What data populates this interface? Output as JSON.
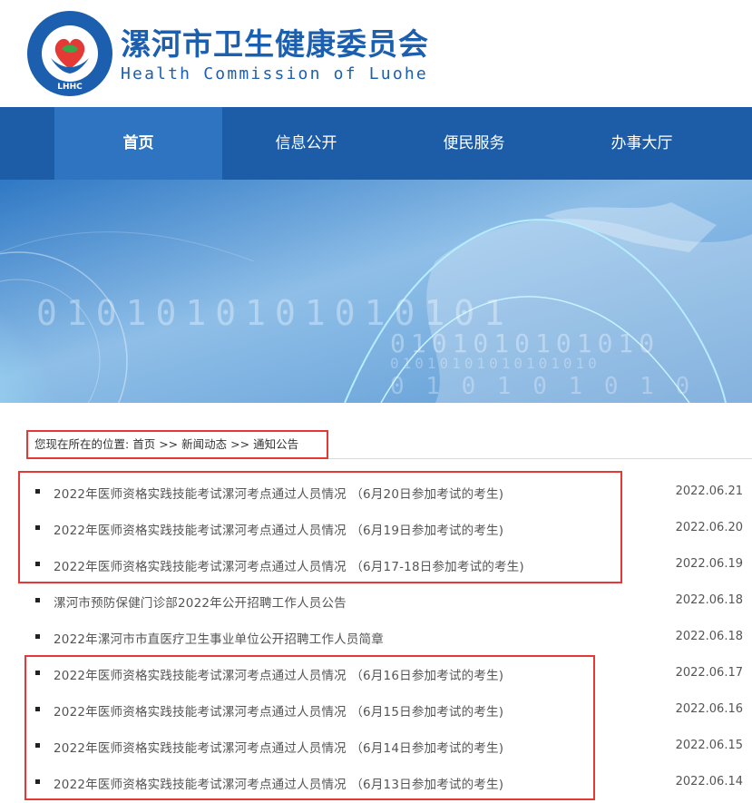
{
  "header": {
    "title_cn": "漯河市卫生健康委员会",
    "title_en": "Health Commission of Luohe",
    "logo_ring_text": "漯河市卫生健康委员会",
    "logo_abbr": "LHHC"
  },
  "nav": {
    "items": [
      {
        "label": "首页",
        "active": true
      },
      {
        "label": "信息公开",
        "active": false
      },
      {
        "label": "便民服务",
        "active": false
      },
      {
        "label": "办事大厅",
        "active": false
      }
    ]
  },
  "banner": {
    "digits_row1": "0101010101010101",
    "digits_row2": "0101010101010",
    "digits_row3": "01010101010101010",
    "digits_row4": "0 1 0 1 0 1 0 1 0"
  },
  "breadcrumb": {
    "prefix": "您现在所在的位置:",
    "home": "首页",
    "sep1": ">>",
    "section": "新闻动态",
    "sep2": ">>",
    "current": "通知公告"
  },
  "news": [
    {
      "title": "2022年医师资格实践技能考试漯河考点通过人员情况 （6月20日参加考试的考生)",
      "date": "2022.06.21"
    },
    {
      "title": "2022年医师资格实践技能考试漯河考点通过人员情况 （6月19日参加考试的考生)",
      "date": "2022.06.20"
    },
    {
      "title": "2022年医师资格实践技能考试漯河考点通过人员情况 （6月17-18日参加考试的考生)",
      "date": "2022.06.19"
    },
    {
      "title": "漯河市预防保健门诊部2022年公开招聘工作人员公告",
      "date": "2022.06.18"
    },
    {
      "title": "2022年漯河市市直医疗卫生事业单位公开招聘工作人员简章",
      "date": "2022.06.18"
    },
    {
      "title": "2022年医师资格实践技能考试漯河考点通过人员情况 （6月16日参加考试的考生)",
      "date": "2022.06.17"
    },
    {
      "title": "2022年医师资格实践技能考试漯河考点通过人员情况 （6月15日参加考试的考生)",
      "date": "2022.06.16"
    },
    {
      "title": "2022年医师资格实践技能考试漯河考点通过人员情况 （6月14日参加考试的考生)",
      "date": "2022.06.15"
    },
    {
      "title": "2022年医师资格实践技能考试漯河考点通过人员情况 （6月13日参加考试的考生)",
      "date": "2022.06.14"
    }
  ],
  "colors": {
    "brand": "#1c5fae",
    "nav_bg": "#1d5da8",
    "nav_active": "#2f74c0",
    "highlight": "#e53935"
  }
}
